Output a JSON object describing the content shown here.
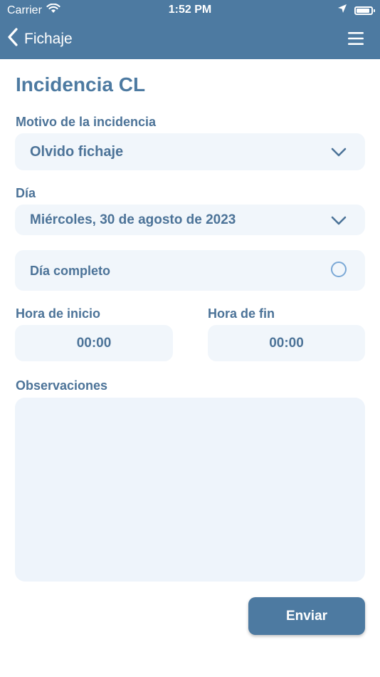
{
  "status_bar": {
    "carrier": "Carrier",
    "time": "1:52 PM"
  },
  "nav": {
    "back_label": "Fichaje"
  },
  "page": {
    "title": "Incidencia CL"
  },
  "form": {
    "motivo_label": "Motivo de la incidencia",
    "motivo_value": "Olvido fichaje",
    "dia_label": "Día",
    "dia_value": "Miércoles, 30 de agosto de 2023",
    "dia_completo_label": "Día completo",
    "hora_inicio_label": "Hora de inicio",
    "hora_inicio_value": "00:00",
    "hora_fin_label": "Hora de fin",
    "hora_fin_value": "00:00",
    "observaciones_label": "Observaciones",
    "observaciones_value": "",
    "submit_label": "Enviar"
  },
  "colors": {
    "header": "#4d7aa1",
    "text": "#4c7398",
    "field_bg": "#f1f6fb",
    "radio_border": "#7aa8d6"
  }
}
